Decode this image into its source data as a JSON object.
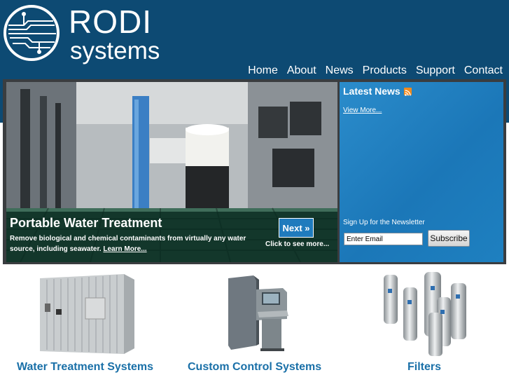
{
  "brand": {
    "name": "RODI",
    "tagline": "systems"
  },
  "nav": [
    {
      "label": "Home"
    },
    {
      "label": "About"
    },
    {
      "label": "News"
    },
    {
      "label": "Products"
    },
    {
      "label": "Support"
    },
    {
      "label": "Contact"
    }
  ],
  "hero": {
    "title": "Portable Water Treatment",
    "description": "Remove biological and chemical contaminants from virtually any water source, including seawater.",
    "learn_more": "Learn More...",
    "next_label": "Next »",
    "next_hint": "Click to see more..."
  },
  "news": {
    "title": "Latest News",
    "view_more": "View More...",
    "newsletter_label": "Sign Up for the Newsletter",
    "email_value": "Enter Email",
    "subscribe_label": "Subscribe"
  },
  "products": [
    {
      "label": "Water Treatment Systems",
      "icon": "shipping-container-image"
    },
    {
      "label": "Custom Control Systems",
      "icon": "control-cabinet-image"
    },
    {
      "label": "Filters",
      "icon": "filter-housings-image"
    }
  ],
  "colors": {
    "header_bg": "#0d4a73",
    "news_bg": "#1b77b8",
    "product_label": "#1a70a8",
    "next_button": "#1f7bbd"
  }
}
